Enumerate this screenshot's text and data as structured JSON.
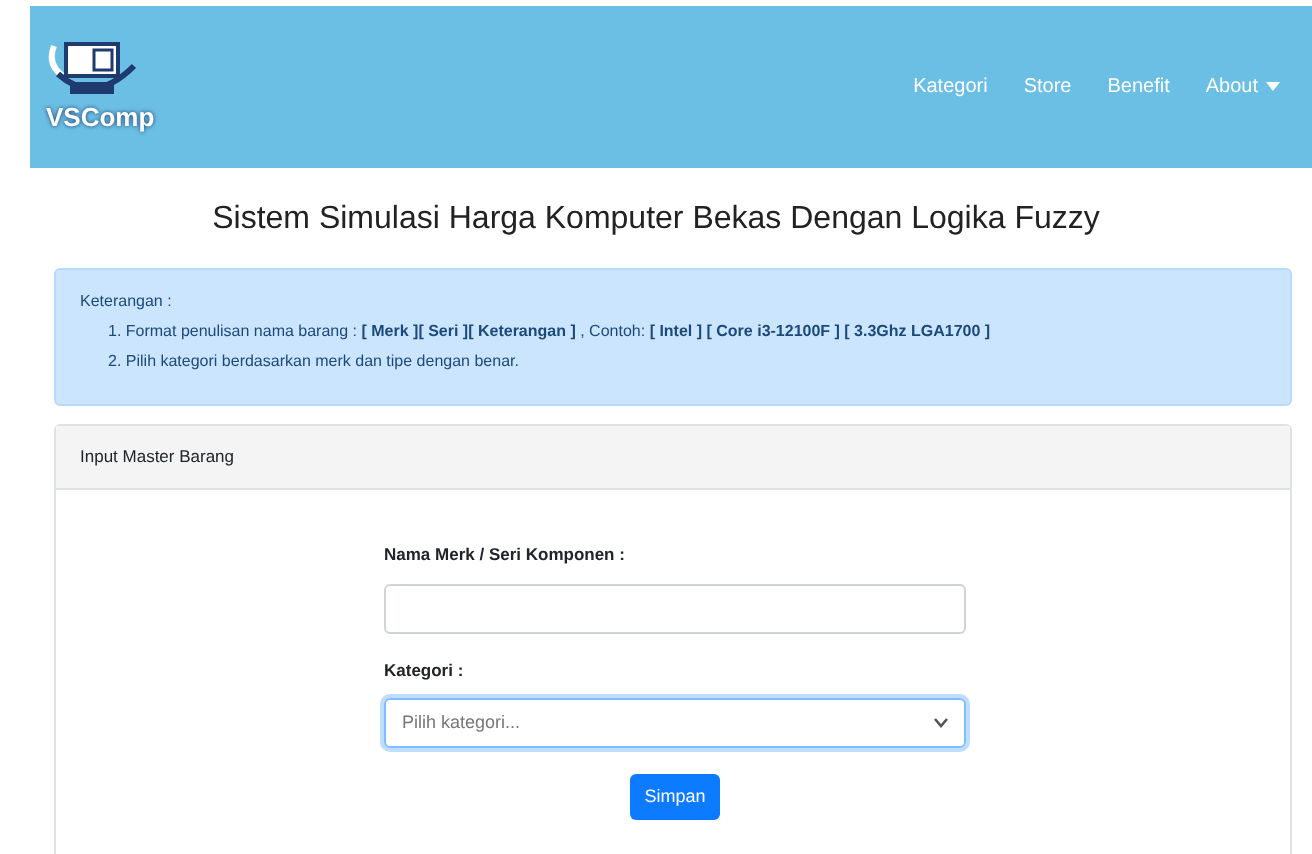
{
  "navbar": {
    "brand": "VSComp",
    "links": [
      {
        "label": "Kategori",
        "dropdown": false
      },
      {
        "label": "Store",
        "dropdown": false
      },
      {
        "label": "Benefit",
        "dropdown": false
      },
      {
        "label": "About",
        "dropdown": true
      }
    ]
  },
  "title": "Sistem Simulasi Harga Komputer Bekas Dengan Logika Fuzzy",
  "alert": {
    "heading": "Keterangan :",
    "items": [
      "1. Format penulisan nama barang : **[ Merk ][ Seri ][ Keterangan ]** , Contoh: **[ Intel ] [ Core i3-12100F ] [ 3.3Ghz LGA1700 ]**",
      "2. Pilih kategori berdasarkan merk dan tipe dengan benar."
    ]
  },
  "card": {
    "header": "Input Master Barang",
    "fields": [
      {
        "kind": "text",
        "label": "Nama Merk / Seri Komponen :",
        "focused": false
      },
      {
        "kind": "select",
        "label": "Kategori :",
        "placeholder": "Pilih kategori...",
        "focused": true
      }
    ],
    "button": "Simpan"
  }
}
